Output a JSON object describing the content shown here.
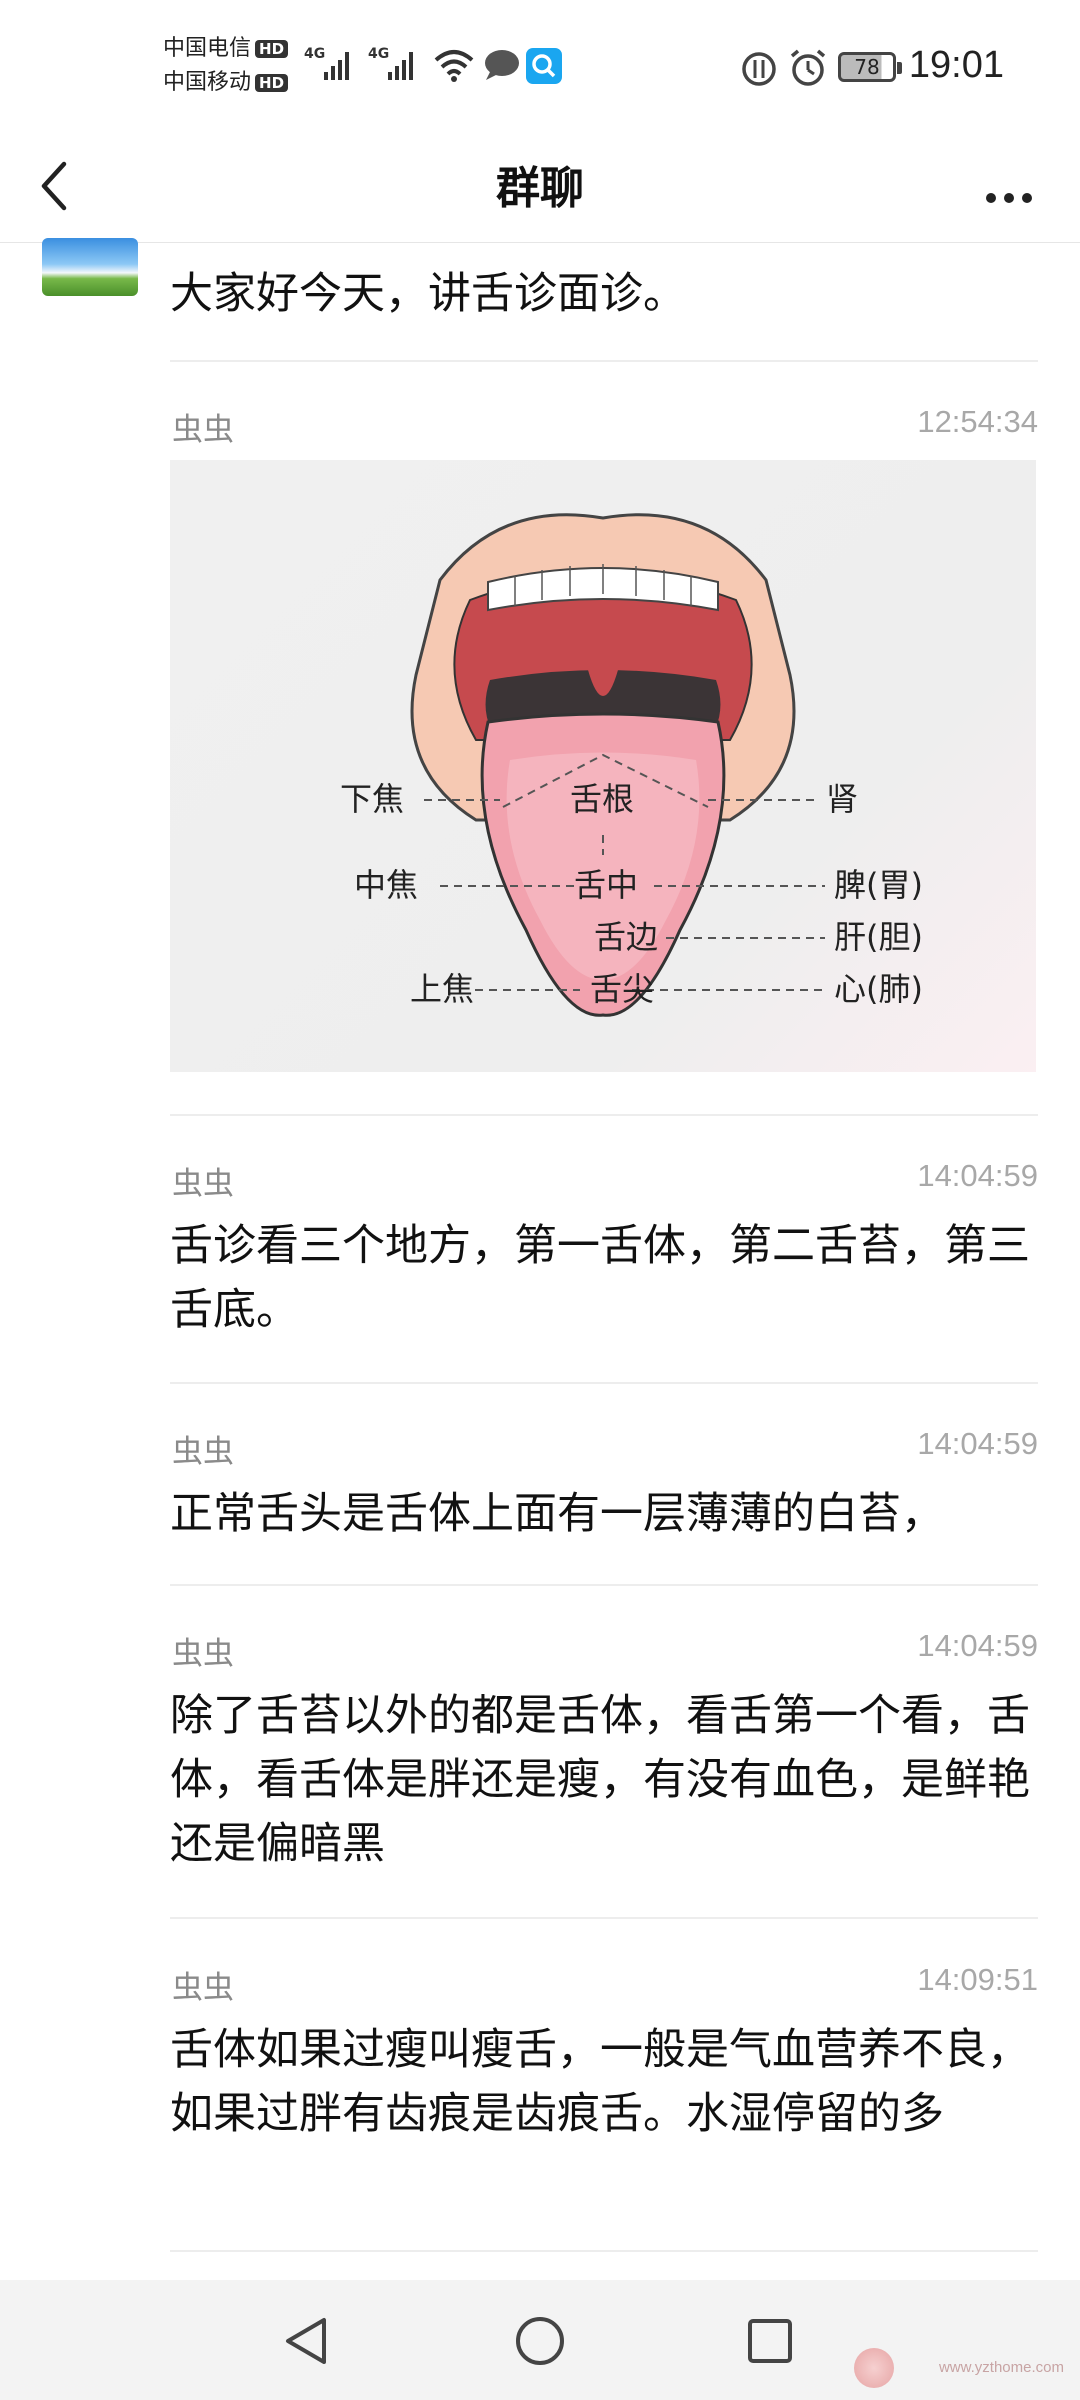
{
  "status_bar": {
    "carrier1": "中国电信",
    "carrier2": "中国移动",
    "hd_badge": "HD",
    "network1": "4G",
    "network2": "4G",
    "battery_level": "78",
    "time": "19:01"
  },
  "header": {
    "title": "群聊"
  },
  "messages": [
    {
      "sender": "",
      "time": "",
      "text": "大家好今天，讲舌诊面诊。"
    },
    {
      "sender": "虫虫",
      "time": "12:54:34",
      "text": ""
    },
    {
      "sender": "虫虫",
      "time": "14:04:59",
      "text": "舌诊看三个地方，第一舌体，第二舌苔，第三舌底。"
    },
    {
      "sender": "虫虫",
      "time": "14:04:59",
      "text": "正常舌头是舌体上面有一层薄薄的白苔，"
    },
    {
      "sender": "虫虫",
      "time": "14:04:59",
      "text": "除了舌苔以外的都是舌体，看舌第一个看，舌体，看舌体是胖还是瘦，有没有血色，是鲜艳还是偏暗黑"
    },
    {
      "sender": "虫虫",
      "time": "14:09:51",
      "text": "舌体如果过瘦叫瘦舌，一般是气血营养不良，如果过胖有齿痕是齿痕舌。水湿停留的多"
    }
  ],
  "tongue_diagram": {
    "center_labels": [
      "舌根",
      "舌中",
      "舌边",
      "舌尖"
    ],
    "left_labels": [
      "下焦",
      "中焦",
      "上焦"
    ],
    "right_labels": [
      "肾",
      "脾(胃)",
      "肝(胆)",
      "心(肺)"
    ]
  },
  "watermark": "www.yzthome.com",
  "colors": {
    "sender": "#8a8a8a",
    "timestamp": "#a8a8a8",
    "divider": "#ededed",
    "nav_bg": "#f3f3f3"
  }
}
